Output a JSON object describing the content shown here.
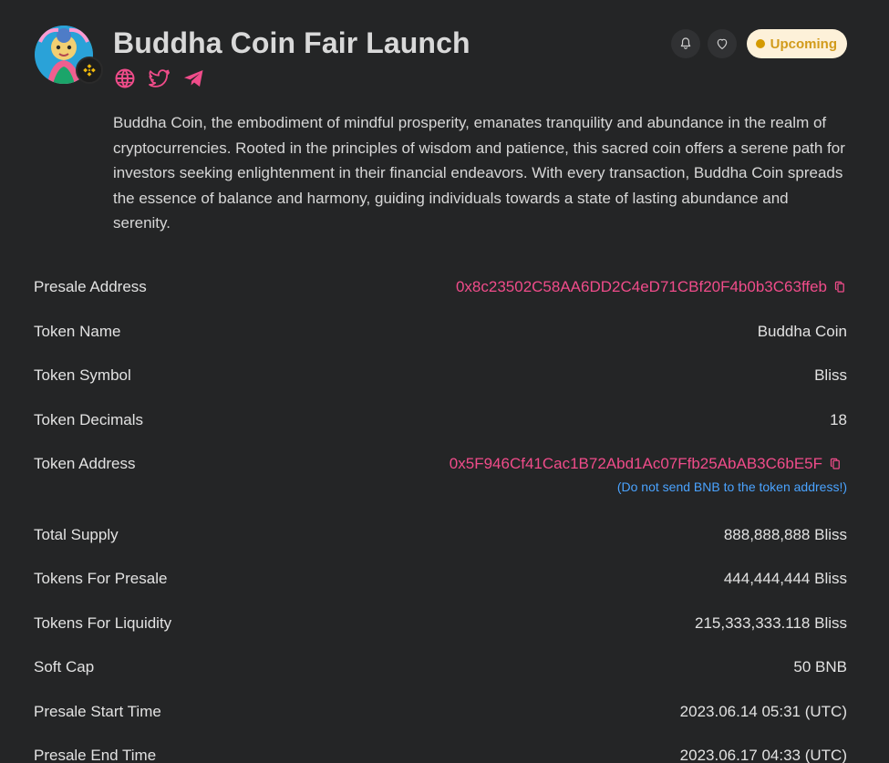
{
  "header": {
    "title": "Buddha Coin Fair Launch",
    "status_label": "Upcoming",
    "socials": [
      "globe-icon",
      "twitter-icon",
      "telegram-icon"
    ]
  },
  "description": "Buddha Coin, the embodiment of mindful prosperity, emanates tranquility and abundance in the realm of cryptocurrencies. Rooted in the principles of wisdom and patience, this sacred coin offers a serene path for investors seeking enlightenment in their financial endeavors. With every transaction, Buddha Coin spreads the essence of balance and harmony, guiding individuals towards a state of lasting abundance and serenity.",
  "details": [
    {
      "label": "Presale Address",
      "value": "0x8c23502C58AA6DD2C4eD71CBf20F4b0b3C63ffeb"
    },
    {
      "label": "Token Name",
      "value": "Buddha Coin"
    },
    {
      "label": "Token Symbol",
      "value": "Bliss"
    },
    {
      "label": "Token Decimals",
      "value": "18"
    },
    {
      "label": "Token Address",
      "value": "0x5F946Cf41Cac1B72Abd1Ac07Ffb25AbAB3C6bE5F",
      "note": "(Do not send BNB to the token address!)"
    },
    {
      "label": "Total Supply",
      "value": "888,888,888 Bliss"
    },
    {
      "label": "Tokens For Presale",
      "value": "444,444,444 Bliss"
    },
    {
      "label": "Tokens For Liquidity",
      "value": "215,333,333.118 Bliss"
    },
    {
      "label": "Soft Cap",
      "value": "50 BNB"
    },
    {
      "label": "Presale Start Time",
      "value": "2023.06.14 05:31 (UTC)"
    },
    {
      "label": "Presale End Time",
      "value": "2023.06.17 04:33 (UTC)"
    }
  ],
  "colors": {
    "background": "#242526",
    "accent_pink": "#f04c8a",
    "note_blue": "#4aa3ff",
    "status_bg": "#fdf1d9",
    "status_text": "#d29b1b"
  },
  "icons": {
    "bell": "bell-icon",
    "heart": "heart-icon",
    "copy": "copy-icon",
    "chain": "bnb-chain-icon"
  }
}
